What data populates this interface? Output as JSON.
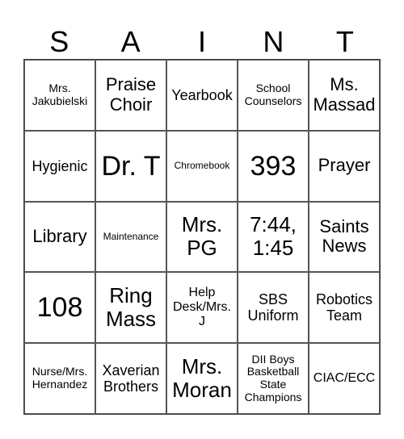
{
  "header": [
    "S",
    "A",
    "I",
    "N",
    "T"
  ],
  "cells": [
    {
      "text": "Mrs. Jakubielski",
      "size": "xs"
    },
    {
      "text": "Praise Choir",
      "size": "l"
    },
    {
      "text": "Yearbook",
      "size": "m"
    },
    {
      "text": "School Counselors",
      "size": "xs"
    },
    {
      "text": "Ms. Massad",
      "size": "l"
    },
    {
      "text": "Hygienic",
      "size": "m"
    },
    {
      "text": "Dr. T",
      "size": "xxxl"
    },
    {
      "text": "Chromebook",
      "size": "xxs"
    },
    {
      "text": "393",
      "size": "xxxl"
    },
    {
      "text": "Prayer",
      "size": "l"
    },
    {
      "text": "Library",
      "size": "l"
    },
    {
      "text": "Maintenance",
      "size": "xxs"
    },
    {
      "text": "Mrs. PG",
      "size": "xl"
    },
    {
      "text": "7:44, 1:45",
      "size": "xl"
    },
    {
      "text": "Saints News",
      "size": "l"
    },
    {
      "text": "108",
      "size": "xxxl"
    },
    {
      "text": "Ring Mass",
      "size": "xl"
    },
    {
      "text": "Help Desk/Mrs. J",
      "size": "s"
    },
    {
      "text": "SBS Uniform",
      "size": "m"
    },
    {
      "text": "Robotics Team",
      "size": "m"
    },
    {
      "text": "Nurse/Mrs. Hernandez",
      "size": "xs"
    },
    {
      "text": "Xaverian Brothers",
      "size": "m"
    },
    {
      "text": "Mrs. Moran",
      "size": "xl"
    },
    {
      "text": "DII Boys Basketball State Champions",
      "size": "xs"
    },
    {
      "text": "CIAC/ECC",
      "size": "s"
    }
  ]
}
